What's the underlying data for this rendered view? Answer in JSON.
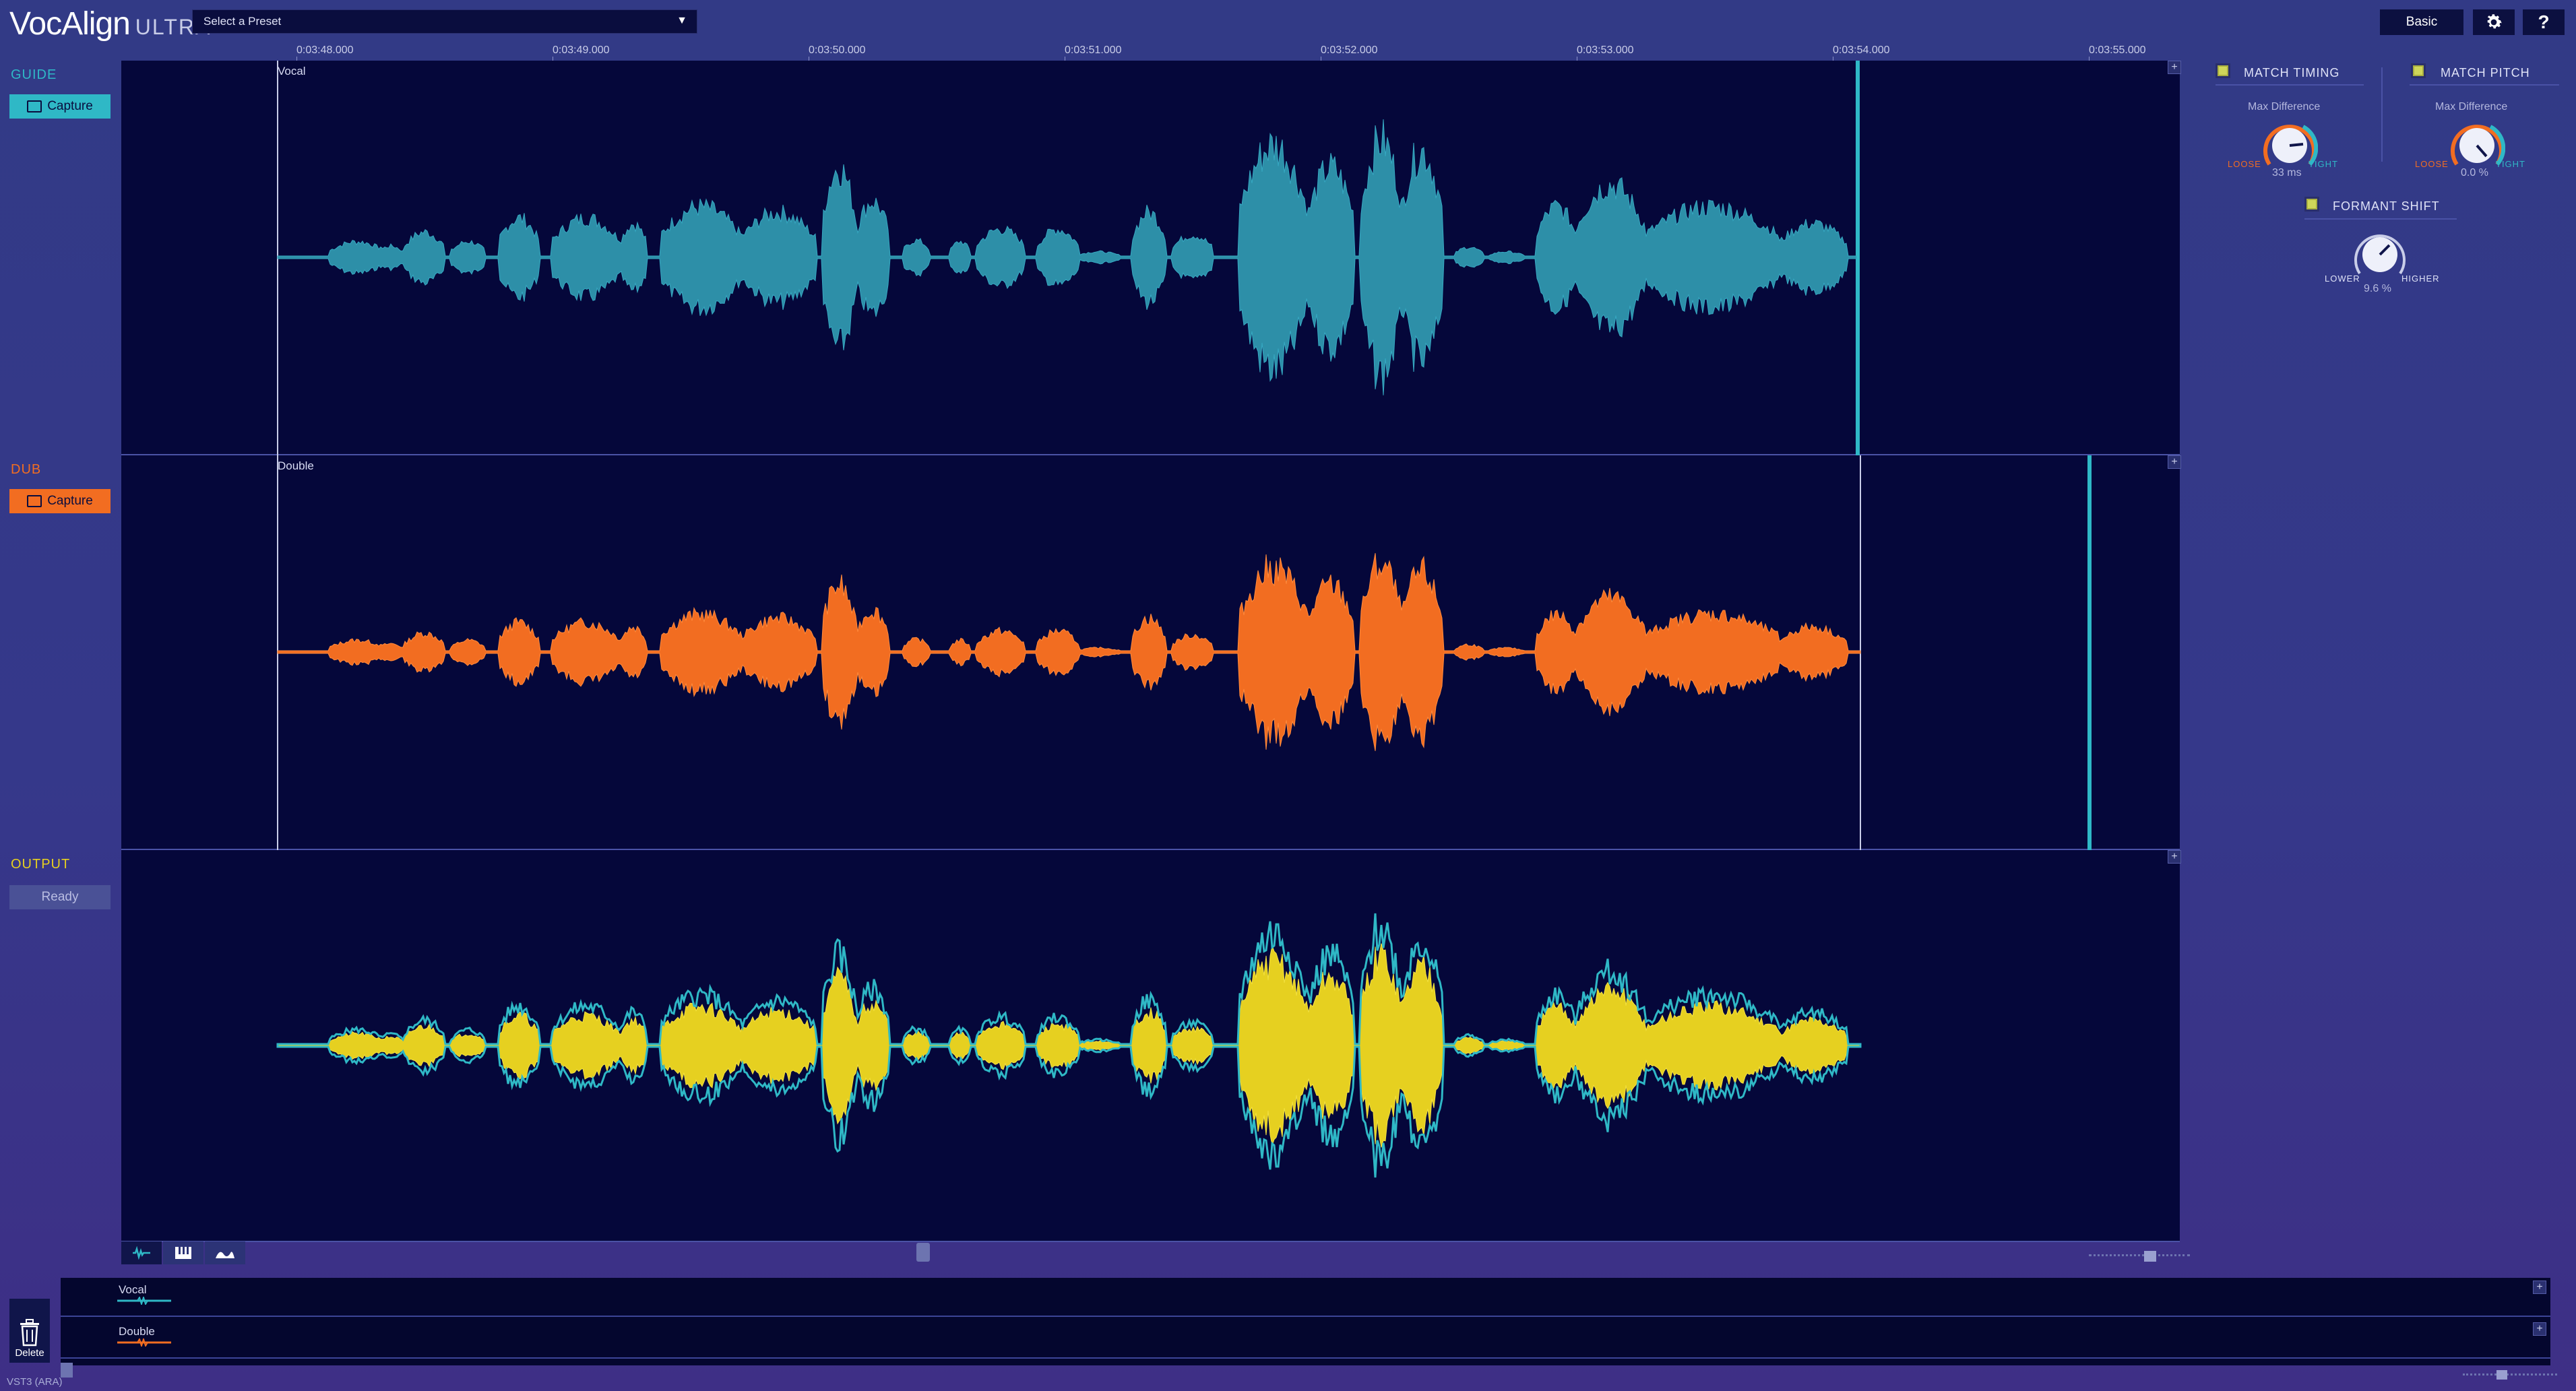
{
  "app": {
    "name": "VocAlign",
    "edition": "ULTRA"
  },
  "toolbar": {
    "preset_placeholder": "Select a Preset",
    "mode_label": "Basic",
    "help_label": "?"
  },
  "sections": {
    "guide": {
      "label": "GUIDE",
      "button": "Capture",
      "color": "#2fb8c6"
    },
    "dub": {
      "label": "DUB",
      "button": "Capture",
      "color": "#f26d21"
    },
    "output": {
      "label": "OUTPUT",
      "status": "Ready",
      "color": "#e6d020"
    }
  },
  "timeline": {
    "ticks": [
      "0:03:48.000",
      "0:03:49.000",
      "0:03:50.000",
      "0:03:51.000",
      "0:03:52.000",
      "0:03:53.000",
      "0:03:54.000",
      "0:03:55.000"
    ]
  },
  "lanes": {
    "guide_clip": "Vocal",
    "dub_clip": "Double"
  },
  "controls": {
    "match_timing": {
      "title": "MATCH TIMING",
      "knob_label": "Max Difference",
      "left": "LOOSE",
      "right": "TIGHT",
      "value": "33 ms"
    },
    "match_pitch": {
      "title": "MATCH PITCH",
      "knob_label": "Max Difference",
      "left": "LOOSE",
      "right": "TIGHT",
      "value": "0.0 %"
    },
    "formant_shift": {
      "title": "FORMANT SHIFT",
      "left": "LOWER",
      "right": "HIGHER",
      "value": "9.6 %"
    }
  },
  "overview": {
    "tracks": [
      "Vocal",
      "Double"
    ],
    "delete_label": "Delete"
  },
  "status": {
    "plugin": "VST3 (ARA)"
  },
  "colors": {
    "guide": "#2fb8c6",
    "dub": "#f26d21",
    "output": "#e6d020",
    "background": "#05073a",
    "accent": "#2fb8c6"
  }
}
